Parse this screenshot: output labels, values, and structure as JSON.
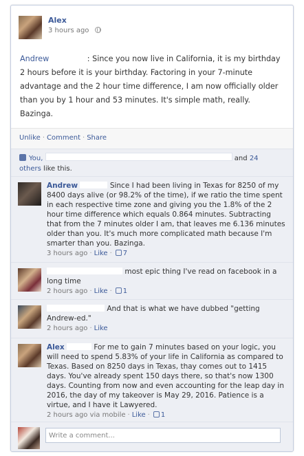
{
  "post": {
    "author": "Alex",
    "time": "3 hours ago",
    "mention": "Andrew",
    "text": ": Since you now live in California, it is my birthday 2 hours before it is your birthday. Factoring in your 7-minute advantage and the 2 hour time difference, I am now officially older than you by 1 hour and 53 minutes. It's simple math, really. Bazinga."
  },
  "actions": {
    "unlike": "Unlike",
    "comment": "Comment",
    "share": "Share"
  },
  "likes": {
    "you": "You,",
    "and": "and",
    "count": "24",
    "others": "others",
    "suffix": "like this."
  },
  "comments": [
    {
      "name": "Andrew",
      "text": "Since I had been living in Texas for 8250 of my 8400 days alive (or 98.2% of the time), if we ratio the time spent in each respective time zone and giving you the 1.8% of the 2 hour time difference which equals 0.864 minutes. Subtracting that from the 7 minutes older I am, that leaves me 6.136 minutes older than you. It's much more complicated math because I'm smarter than you. Bazinga.",
      "time": "3 hours ago",
      "like": "Like",
      "likes": "7"
    },
    {
      "name": "",
      "text": "most epic thing I've read on facebook in a long time",
      "time": "2 hours ago",
      "like": "Like",
      "likes": "1"
    },
    {
      "name": "",
      "text": "And that is what we have dubbed \"getting Andrew-ed.\"",
      "time": "2 hours ago",
      "like": "Like",
      "likes": ""
    },
    {
      "name": "Alex",
      "text": "For me to gain 7 minutes based on your logic, you will need to spend 5.83% of your life in California as compared to Texas. Based on 8250 days in Texas, thay comes out to 1415 days. You've already spent 150 days there, so that's now 1300 days. Counting from now and even accounting for the leap day in 2016, the day of my takeover is May 29, 2016. Patience is a virtue, and I have it Lawyered.",
      "time": "2 hours ago via mobile",
      "like": "Like",
      "likes": "1"
    }
  ],
  "composer": {
    "placeholder": "Write a comment..."
  },
  "colors": {
    "link": "#3b5998",
    "comment_bg": "#edeff4",
    "border": "#c4cde0"
  }
}
